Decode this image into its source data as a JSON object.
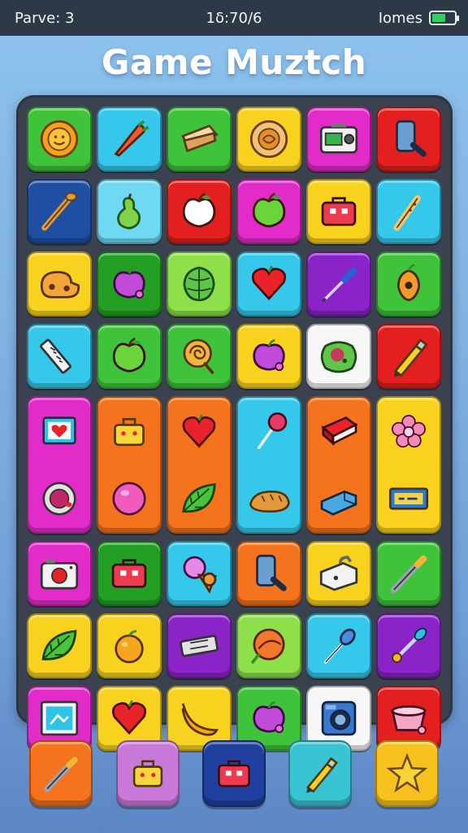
{
  "status_bar": {
    "left": "Parve: 3",
    "center": "1δ:70/6",
    "right": "Iomes",
    "battery_level": 0.6
  },
  "title": "Game Muztch",
  "colors": {
    "green": "#3fc33a",
    "cyan": "#35c8ea",
    "yellow": "#f8d21e",
    "magenta": "#e22bc8",
    "red": "#e3201f",
    "navy": "#1f4fa3",
    "lightcyan": "#6fd8f2",
    "purple": "#8a24c8",
    "orange": "#f4731c",
    "lime": "#8ee04a",
    "white": "#f7f7f7",
    "darkgreen": "#23a024"
  },
  "board": {
    "tiles": [
      {
        "icon": "sun-icon",
        "color": "green"
      },
      {
        "icon": "carrot-icon",
        "color": "cyan"
      },
      {
        "icon": "sandwich-icon",
        "color": "green"
      },
      {
        "icon": "pie-icon",
        "color": "yellow"
      },
      {
        "icon": "radio-icon",
        "color": "magenta"
      },
      {
        "icon": "phone-icon",
        "color": "red"
      },
      {
        "icon": "bat-icon",
        "color": "navy"
      },
      {
        "icon": "pear-icon",
        "color": "lightcyan"
      },
      {
        "icon": "apple-icon",
        "color": "red"
      },
      {
        "icon": "apple-icon",
        "color": "magenta"
      },
      {
        "icon": "toolbox-icon",
        "color": "yellow"
      },
      {
        "icon": "club-icon",
        "color": "cyan"
      },
      {
        "icon": "bread-icon",
        "color": "yellow"
      },
      {
        "icon": "plum-icon",
        "color": "darkgreen"
      },
      {
        "icon": "cabbage-icon",
        "color": "lime"
      },
      {
        "icon": "heart-icon",
        "color": "cyan"
      },
      {
        "icon": "screwdriver-icon",
        "color": "purple"
      },
      {
        "icon": "mango-icon",
        "color": "green"
      },
      {
        "icon": "ruler-icon",
        "color": "cyan"
      },
      {
        "icon": "apple-icon",
        "color": "green"
      },
      {
        "icon": "swirl-icon",
        "color": "green"
      },
      {
        "icon": "plum-icon",
        "color": "yellow"
      },
      {
        "icon": "slime-icon",
        "color": "white"
      },
      {
        "icon": "pencil-icon",
        "color": "red"
      },
      {
        "icon": "frame-heart-icon",
        "color": "magenta",
        "tall": true,
        "icon2": "ring-icon"
      },
      {
        "icon": "bag-icon",
        "color": "orange",
        "tall": true,
        "icon2": "ball-icon"
      },
      {
        "icon": "heart-icon",
        "color": "orange",
        "tall": true,
        "icon2": "leaf-icon"
      },
      {
        "icon": "lollipop-icon",
        "color": "cyan",
        "tall": true,
        "icon2": "bread-loaf-icon"
      },
      {
        "icon": "book-icon",
        "color": "orange",
        "tall": true,
        "icon2": "eraser-icon"
      },
      {
        "icon": "flower-icon",
        "color": "yellow",
        "tall": true,
        "icon2": "sign-icon"
      },
      {
        "icon": "camera-icon",
        "color": "magenta"
      },
      {
        "icon": "toolbox-icon",
        "color": "darkgreen"
      },
      {
        "icon": "icecream-icon",
        "color": "cyan"
      },
      {
        "icon": "phone-icon",
        "color": "orange"
      },
      {
        "icon": "sink-icon",
        "color": "yellow"
      },
      {
        "icon": "pen-icon",
        "color": "green"
      },
      {
        "icon": "leaf-icon",
        "color": "yellow"
      },
      {
        "icon": "orange-fruit-icon",
        "color": "yellow"
      },
      {
        "icon": "bandage-icon",
        "color": "purple"
      },
      {
        "icon": "cookie-icon",
        "color": "lime"
      },
      {
        "icon": "spoon-icon",
        "color": "cyan"
      },
      {
        "icon": "dropper-icon",
        "color": "purple"
      },
      {
        "icon": "picture-icon",
        "color": "magenta"
      },
      {
        "icon": "heart-icon",
        "color": "yellow"
      },
      {
        "icon": "banana-icon",
        "color": "yellow"
      },
      {
        "icon": "plum-icon",
        "color": "green"
      },
      {
        "icon": "washer-icon",
        "color": "white"
      },
      {
        "icon": "bucket-icon",
        "color": "red"
      }
    ]
  },
  "toolbar": {
    "items": [
      {
        "icon": "pen-icon",
        "color": "orange",
        "label": "pen"
      },
      {
        "icon": "bag-icon",
        "color": "#c97ad9",
        "label": "bag"
      },
      {
        "icon": "toolbox-icon",
        "color": "#2040a0",
        "label": "toolbox"
      },
      {
        "icon": "pencil-icon",
        "color": "#39c4d4",
        "label": "pencil"
      },
      {
        "icon": "star-icon",
        "color": "#f8c21e",
        "label": "star"
      }
    ]
  }
}
